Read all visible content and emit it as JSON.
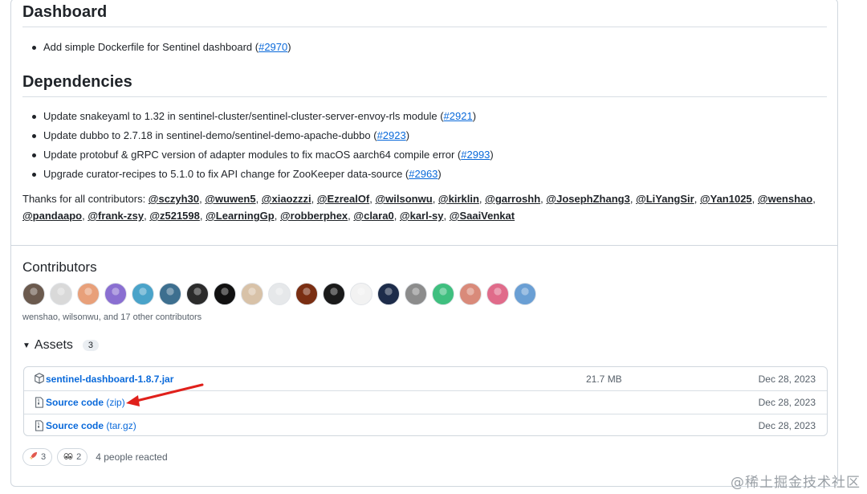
{
  "dashboard": {
    "title": "Dashboard",
    "items": [
      {
        "text": "Add simple Dockerfile for Sentinel dashboard (",
        "issue": "#2970",
        "suffix": ")"
      }
    ]
  },
  "dependencies": {
    "title": "Dependencies",
    "items": [
      {
        "text": "Update snakeyaml to 1.32 in sentinel-cluster/sentinel-cluster-server-envoy-rls module (",
        "issue": "#2921",
        "suffix": ")"
      },
      {
        "text": "Update dubbo to 2.7.18 in sentinel-demo/sentinel-demo-apache-dubbo (",
        "issue": "#2923",
        "suffix": ")"
      },
      {
        "text": "Update protobuf & gRPC version of adapter modules to fix macOS aarch64 compile error (",
        "issue": "#2993",
        "suffix": ")"
      },
      {
        "text": "Upgrade curator-recipes to 5.1.0 to fix API change for ZooKeeper data-source (",
        "issue": "#2963",
        "suffix": ")"
      }
    ]
  },
  "thanks": {
    "prefix": "Thanks for all contributors: ",
    "contributors": [
      "@sczyh30",
      "@wuwen5",
      "@xiaozzzi",
      "@EzrealOf",
      "@wilsonwu",
      "@kirklin",
      "@garroshh",
      "@JosephZhang3",
      "@LiYangSir",
      "@Yan1025",
      "@wenshao",
      "@pandaapo",
      "@frank-zsy",
      "@z521598",
      "@LearningGp",
      "@robberphex",
      "@clara0",
      "@karl-sy",
      "@SaaiVenkat"
    ]
  },
  "contributors_section": {
    "title": "Contributors",
    "summary": "wenshao, wilsonwu, and 17 other contributors",
    "avatar_colors": [
      "#6b5a4e",
      "#d9d9d9",
      "#e8a07a",
      "#8a6fd1",
      "#4aa3c9",
      "#3d6f8f",
      "#2b2b2b",
      "#111111",
      "#d8c2a8",
      "#e6e8ea",
      "#7a2e12",
      "#1a1a1a",
      "#f2f2f2",
      "#1d2c4a",
      "#8c8c8c",
      "#3fbf7f",
      "#d98a7a",
      "#e06b8a",
      "#6a9fd4"
    ]
  },
  "assets": {
    "title": "Assets",
    "count": "3",
    "rows": [
      {
        "name": "sentinel-dashboard-1.8.7.jar",
        "sub": "",
        "size": "21.7 MB",
        "date": "Dec 28, 2023",
        "icon": "package-icon"
      },
      {
        "name": "Source code",
        "sub": " (zip)",
        "size": "",
        "date": "Dec 28, 2023",
        "icon": "file-zip-icon"
      },
      {
        "name": "Source code",
        "sub": " (tar.gz)",
        "size": "",
        "date": "Dec 28, 2023",
        "icon": "file-zip-icon"
      }
    ]
  },
  "reactions": {
    "rocket_count": "3",
    "eyes_count": "2",
    "summary": "4 people reacted"
  },
  "annotation": {
    "arrow_color": "#e0201b"
  },
  "watermark": "@稀土掘金技术社区"
}
